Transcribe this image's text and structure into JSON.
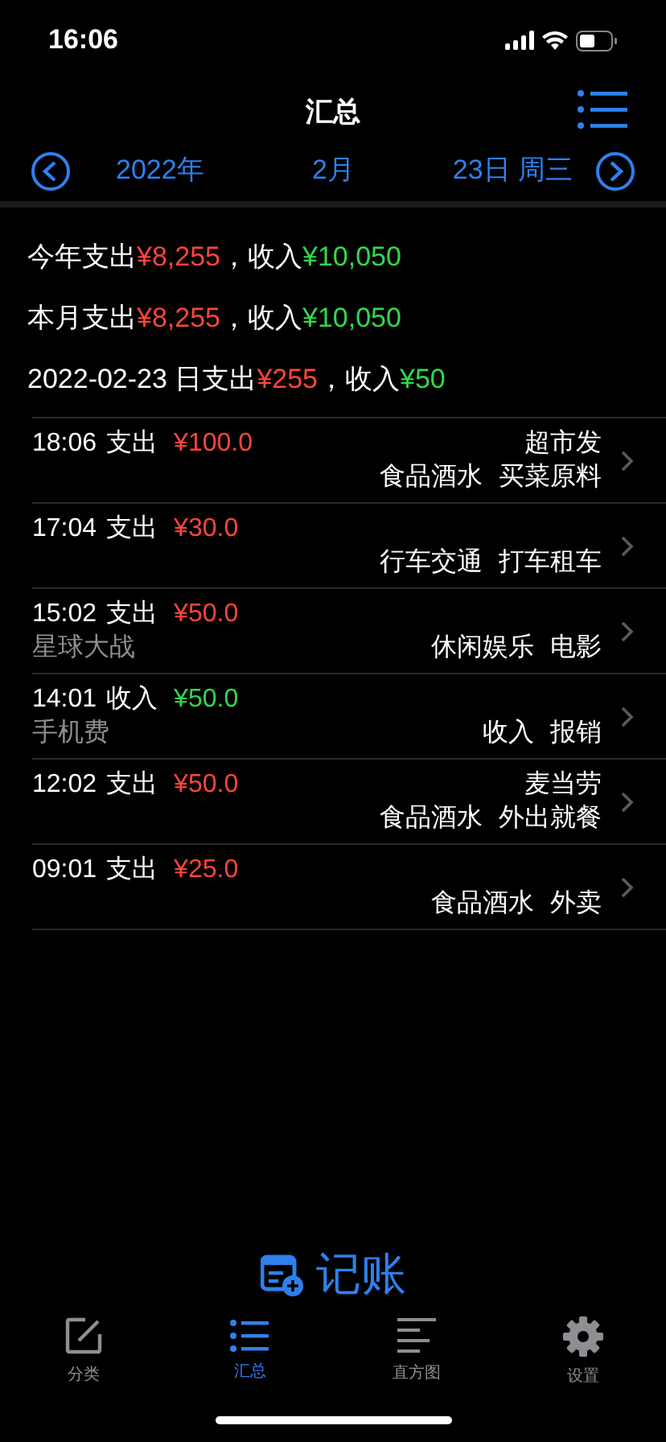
{
  "status_bar": {
    "time": "16:06"
  },
  "nav": {
    "title": "汇总"
  },
  "date_bar": {
    "year": "2022年",
    "month": "2月",
    "day": "23日 周三"
  },
  "summary": [
    {
      "label": "今年支出",
      "expense": "¥8,255",
      "separator": "，收入",
      "income": "¥10,050"
    },
    {
      "label": "本月支出",
      "expense": "¥8,255",
      "separator": "，收入",
      "income": "¥10,050"
    },
    {
      "label": "2022-02-23 日支出",
      "expense": "¥255",
      "separator": "，收入",
      "income": "¥50"
    }
  ],
  "entries": [
    {
      "time": "18:06",
      "type": "支出",
      "kind": "expense",
      "amount": "¥100.0",
      "merchant": "超市发",
      "category": "食品酒水",
      "subcategory": "买菜原料"
    },
    {
      "time": "17:04",
      "type": "支出",
      "kind": "expense",
      "amount": "¥30.0",
      "category": "行车交通",
      "subcategory": "打车租车"
    },
    {
      "time": "15:02",
      "type": "支出",
      "kind": "expense",
      "amount": "¥50.0",
      "note": "星球大战",
      "category": "休闲娱乐",
      "subcategory": "电影"
    },
    {
      "time": "14:01",
      "type": "收入",
      "kind": "income",
      "amount": "¥50.0",
      "note": "手机费",
      "category": "收入",
      "subcategory": "报销"
    },
    {
      "time": "12:02",
      "type": "支出",
      "kind": "expense",
      "amount": "¥50.0",
      "merchant": "麦当劳",
      "category": "食品酒水",
      "subcategory": "外出就餐"
    },
    {
      "time": "09:01",
      "type": "支出",
      "kind": "expense",
      "amount": "¥25.0",
      "category": "食品酒水",
      "subcategory": "外卖"
    }
  ],
  "record_button": {
    "label": "记账"
  },
  "tabs": [
    {
      "label": "分类",
      "kind": "edit",
      "selected": false
    },
    {
      "label": "汇总",
      "kind": "list",
      "selected": true
    },
    {
      "label": "直方图",
      "kind": "lines",
      "selected": false
    },
    {
      "label": "设置",
      "kind": "gear",
      "selected": false
    }
  ]
}
